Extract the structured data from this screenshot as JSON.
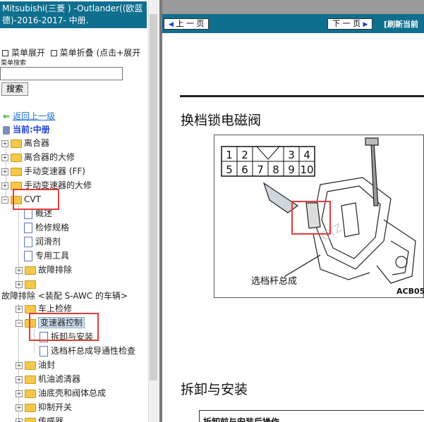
{
  "window": {
    "title": "Mitsubishi(三菱 ) -Outlander((欧蓝德)-2016-2017- 中册."
  },
  "sidebar": {
    "expand_label": "菜单展开",
    "collapse_label": "菜单折叠 (点击+展开",
    "search_label": "菜单搜索",
    "search_value": "",
    "search_button": "搜索",
    "back_link": "返回上一级",
    "current": "当前:中册"
  },
  "tree": [
    {
      "label": "离合器",
      "level": 0,
      "kind": "folder",
      "toggle": "+"
    },
    {
      "label": "离合器的大修",
      "level": 0,
      "kind": "folder",
      "toggle": "+"
    },
    {
      "label": "手动变速器 (FF)",
      "level": 0,
      "kind": "folder",
      "toggle": "+"
    },
    {
      "label": "手动变速器的大修",
      "level": 0,
      "kind": "folder",
      "toggle": "+"
    },
    {
      "label": "CVT",
      "level": 0,
      "kind": "folder",
      "toggle": "−"
    },
    {
      "label": "概述",
      "level": 1,
      "kind": "doc"
    },
    {
      "label": "检修规格",
      "level": 1,
      "kind": "doc"
    },
    {
      "label": "润滑剂",
      "level": 1,
      "kind": "doc"
    },
    {
      "label": "专用工具",
      "level": 1,
      "kind": "doc"
    },
    {
      "label": "故障排除",
      "level": 1,
      "kind": "folder",
      "toggle": "+"
    },
    {
      "label": "",
      "level": 1,
      "kind": "folder",
      "toggle": "+"
    },
    {
      "label": "故障排除 <装配 S-AWC 的车辆>",
      "level": -1,
      "kind": "text"
    },
    {
      "label": "车上检修",
      "level": 1,
      "kind": "folder",
      "toggle": "+"
    },
    {
      "label": "变速器控制",
      "level": 1,
      "kind": "folder",
      "toggle": "−",
      "selected": true
    },
    {
      "label": "拆卸与安装",
      "level": 2,
      "kind": "doc"
    },
    {
      "label": "选档杆总成导通性检查",
      "level": 2,
      "kind": "doc"
    },
    {
      "label": "油封",
      "level": 1,
      "kind": "folder",
      "toggle": "+"
    },
    {
      "label": "机油滤清器",
      "level": 1,
      "kind": "folder",
      "toggle": "+"
    },
    {
      "label": "油底壳和阀体总成",
      "level": 1,
      "kind": "folder",
      "toggle": "+"
    },
    {
      "label": "抑制开关",
      "level": 1,
      "kind": "folder",
      "toggle": "+"
    },
    {
      "label": "传感器",
      "level": 1,
      "kind": "folder",
      "toggle": "+"
    }
  ],
  "content": {
    "prev_button": "上 一 页",
    "next_button": "下 一 页",
    "refresh": "[刷新当前",
    "heading_1": "换档锁电磁阀",
    "connector_pins_top": [
      "1",
      "2",
      "",
      "3",
      "4"
    ],
    "connector_pins_bottom": [
      "5",
      "6",
      "7",
      "8",
      "9",
      "10"
    ],
    "caption": "选档杆总成",
    "figure_code": "ACB05",
    "heading_2": "拆卸与安装",
    "bottom_text": "拆卸前与安装后操作"
  },
  "colors": {
    "header_bg": "#0f6f8f",
    "highlight_box": "#e23b3b",
    "link": "#1a6bd0"
  }
}
